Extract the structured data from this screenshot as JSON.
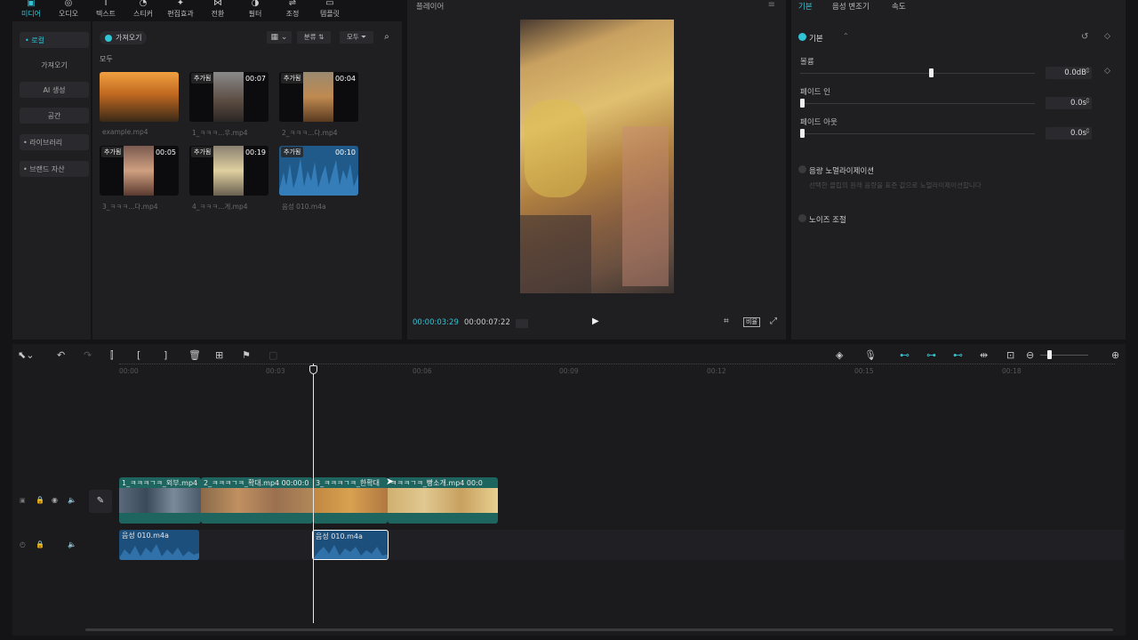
{
  "topnav": {
    "items": [
      {
        "label": "미디어",
        "icon": "media-icon"
      },
      {
        "label": "오디오",
        "icon": "audio-icon"
      },
      {
        "label": "텍스트",
        "icon": "text-icon"
      },
      {
        "label": "스티커",
        "icon": "sticker-icon"
      },
      {
        "label": "편집효과",
        "icon": "effects-icon"
      },
      {
        "label": "전환",
        "icon": "transition-icon"
      },
      {
        "label": "필터",
        "icon": "filter-icon"
      },
      {
        "label": "조정",
        "icon": "adjust-icon"
      },
      {
        "label": "템플릿",
        "icon": "template-icon"
      }
    ]
  },
  "sidebar": {
    "items": [
      "• 로컬",
      "가져오기",
      "AI 생성",
      "공간",
      "• 라이브러리",
      "• 브랜드 자산"
    ]
  },
  "media": {
    "import_label": "가져오기",
    "sort_label": "분류",
    "filter_label": "모두",
    "section_label": "모두",
    "tiles": [
      {
        "badge": "",
        "duration": "",
        "name": "example.mp4"
      },
      {
        "badge": "추가됨",
        "duration": "00:07",
        "name": "1_ㅋㅋㅋ...우.mp4"
      },
      {
        "badge": "추가됨",
        "duration": "00:04",
        "name": "2_ㅋㅋㅋ...다.mp4"
      },
      {
        "badge": "추가됨",
        "duration": "00:05",
        "name": "3_ㅋㅋㅋ...다.mp4"
      },
      {
        "badge": "추가됨",
        "duration": "00:19",
        "name": "4_ㅋㅋㅋ...게.mp4"
      },
      {
        "badge": "추가됨",
        "duration": "00:10",
        "name": "음성 010.m4a"
      }
    ]
  },
  "player": {
    "title": "플레이어",
    "current_time": "00:00:03:29",
    "total_time": "00:00:07:22",
    "ratio_label": "비율"
  },
  "props": {
    "tabs": [
      "기본",
      "음성 변조기",
      "속도"
    ],
    "section_title": "기본",
    "volume_label": "볼륨",
    "volume_value": "0.0dB",
    "volume_level": 0.55,
    "fadein_label": "페이드 인",
    "fadein_value": "0.0s",
    "fadeout_label": "페이드 아웃",
    "fadeout_value": "0.0s",
    "normalize_label": "음량 노멀라이제이션",
    "normalize_desc": "선택한 클립의 원래 음량을 표준 값으로 노멀라이제이션합니다",
    "noise_label": "노이즈 조절"
  },
  "timeline": {
    "ruler": [
      "00:00",
      "00:03",
      "00:06",
      "00:09",
      "00:12",
      "00:15",
      "00:18"
    ],
    "video_clips": [
      {
        "label": "1_ㅋㅋㅋㄱㅋ_외부.mp4"
      },
      {
        "label": "2_ㅋㅋㅋㄱㅋ_확대.mp4  00:00:0"
      },
      {
        "label": "3_ㅋㅋㅋㄱㅋ_한확대"
      },
      {
        "label": "ㅋㅋㅋㄱㅋ_빵소개.mp4  00:0"
      }
    ],
    "audio_clips": [
      {
        "label": "음성 010.m4a"
      },
      {
        "label": "음성 010.m4a"
      }
    ]
  },
  "colors": {
    "accent": "#31c4d5",
    "video_clip": "#1e6560",
    "audio_clip": "#1c4f7c"
  }
}
